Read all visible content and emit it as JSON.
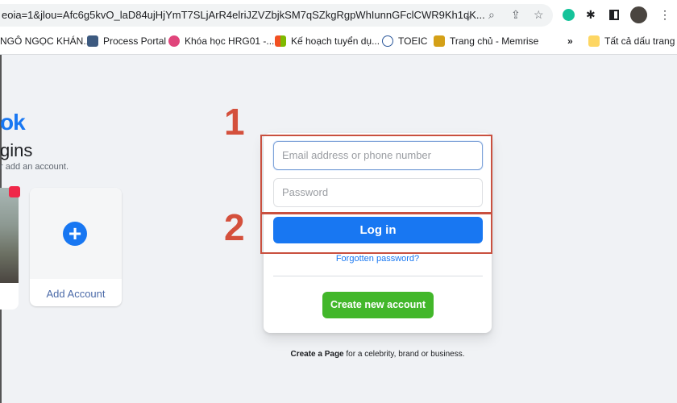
{
  "browser": {
    "url": "eoia=1&jlou=Afc6g5kvO_laD84ujHjYmT7SLjArR4elriJZVZbjkSM7qSZkgRgpWhIunnGFclCWR9Kh1qK...",
    "bookmarks": [
      {
        "label": "NGÔ NGỌC KHÁN...",
        "color": "#ffffff"
      },
      {
        "label": "Process Portal",
        "color": "#3d5a80"
      },
      {
        "label": "Khóa học HRG01 -...",
        "color": "#e0457b"
      },
      {
        "label": "Kế hoạch tuyển dụ...",
        "color": "#f25022"
      },
      {
        "label": "TOEIC",
        "color": "#2b579a"
      },
      {
        "label": "Trang chủ - Memrise",
        "color": "#d4a017"
      }
    ],
    "more": "»",
    "all_bookmarks": "Tất cả dấu trang"
  },
  "left": {
    "logo": "ok",
    "heading": "gins",
    "subtitle": "r add an account.",
    "add_account": "Add Account"
  },
  "login": {
    "email_placeholder": "Email address or phone number",
    "password_placeholder": "Password",
    "login_button": "Log in",
    "forgot": "Forgotten password?",
    "create_button": "Create new account",
    "create_page_bold": "Create a Page",
    "create_page_rest": " for a celebrity, brand or business."
  },
  "annotations": {
    "step1": "1",
    "step2": "2",
    "color": "#d4503c"
  },
  "colors": {
    "brand": "#1877f2",
    "green": "#42b72a"
  }
}
